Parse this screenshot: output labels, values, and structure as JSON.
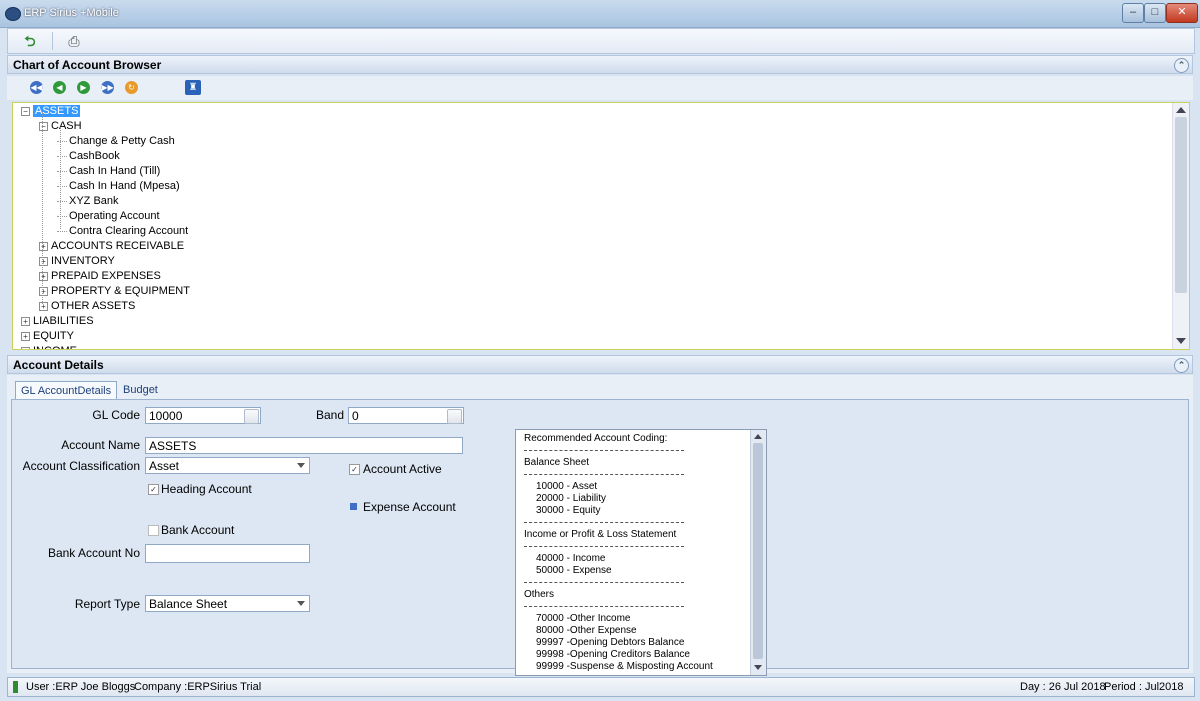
{
  "window": {
    "title": "ERP Sirius +Mobile"
  },
  "toolbar": {
    "icons": [
      "refresh-icon",
      "print-icon"
    ]
  },
  "browser": {
    "title": "Chart of Account Browser",
    "nav_icons": [
      "first-icon",
      "previous-icon",
      "next-icon",
      "last-icon",
      "refresh-icon",
      "find-icon"
    ],
    "tree": [
      {
        "label": "ASSETS",
        "level": 0,
        "expanded": true,
        "selected": true
      },
      {
        "label": "CASH",
        "level": 1,
        "expanded": true
      },
      {
        "label": "Change & Petty Cash",
        "level": 2
      },
      {
        "label": "CashBook",
        "level": 2
      },
      {
        "label": "Cash In Hand (Till)",
        "level": 2
      },
      {
        "label": "Cash In Hand (Mpesa)",
        "level": 2
      },
      {
        "label": "XYZ Bank",
        "level": 2
      },
      {
        "label": "Operating Account",
        "level": 2
      },
      {
        "label": "Contra Clearing Account",
        "level": 2
      },
      {
        "label": "ACCOUNTS RECEIVABLE",
        "level": 1,
        "expanded": false
      },
      {
        "label": "INVENTORY",
        "level": 1,
        "expanded": false
      },
      {
        "label": "PREPAID EXPENSES",
        "level": 1,
        "expanded": false
      },
      {
        "label": "PROPERTY & EQUIPMENT",
        "level": 1,
        "expanded": false
      },
      {
        "label": "OTHER ASSETS",
        "level": 1,
        "expanded": false
      },
      {
        "label": "LIABILITIES",
        "level": 0,
        "expanded": false
      },
      {
        "label": "EQUITY",
        "level": 0,
        "expanded": false
      },
      {
        "label": "INCOME",
        "level": 0,
        "expanded": false
      }
    ]
  },
  "details": {
    "title": "Account Details",
    "tabs": [
      "GL AccountDetails",
      "Budget"
    ],
    "active_tab": "GL AccountDetails",
    "gl_code": {
      "label": "GL Code",
      "value": "10000"
    },
    "band": {
      "label": "Band",
      "value": "0"
    },
    "account_name": {
      "label": "Account Name",
      "value": "ASSETS"
    },
    "account_classification": {
      "label": "Account Classification",
      "value": "Asset"
    },
    "account_active": {
      "label": "Account Active",
      "checked": true
    },
    "heading_account": {
      "label": "Heading Account",
      "checked": true
    },
    "expense_account": {
      "label": "Expense Account",
      "checked": false
    },
    "bank_account": {
      "label": "Bank Account",
      "checked": false
    },
    "bank_account_no": {
      "label": "Bank Account No",
      "value": ""
    },
    "report_type": {
      "label": "Report Type",
      "value": "Balance Sheet"
    },
    "recommended_coding": {
      "title": "Recommended Account Coding:",
      "balance_sheet": "Balance Sheet",
      "bs_items": [
        "10000 - Asset",
        "20000 - Liability",
        "30000 - Equity"
      ],
      "income_statement": "Income or Profit & Loss Statement",
      "is_items": [
        "40000 - Income",
        "50000 - Expense"
      ],
      "others": "Others",
      "other_items": [
        "70000 -Other Income",
        "80000 -Other Expense",
        "99997 -Opening Debtors Balance",
        "99998 -Opening Creditors Balance",
        "99999 -Suspense & Misposting Account"
      ]
    }
  },
  "status": {
    "user": "User :ERP Joe Bloggs",
    "company": "Company :ERPSirius Trial",
    "day": "Day : 26 Jul 2018",
    "period": "Period : Jul2018"
  },
  "colors": {
    "selection": "#3399ff",
    "tree_border": "#c8d35a"
  }
}
